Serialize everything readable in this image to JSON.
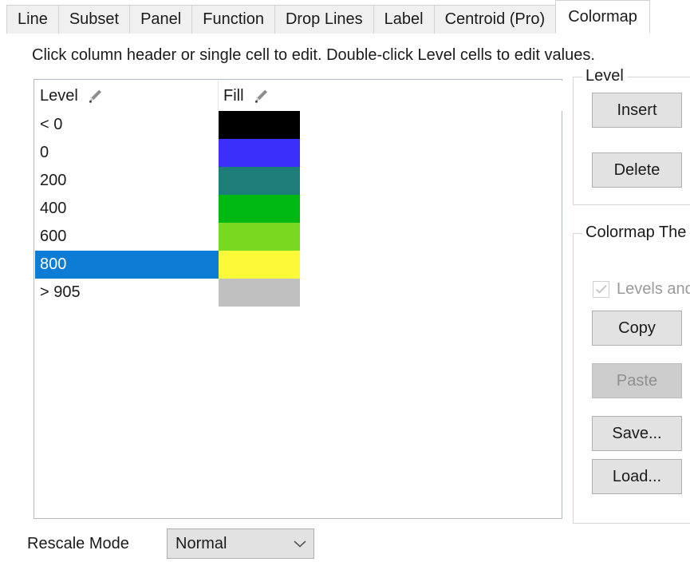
{
  "tabs": [
    {
      "label": "Line",
      "active": false
    },
    {
      "label": "Subset",
      "active": false
    },
    {
      "label": "Panel",
      "active": false
    },
    {
      "label": "Function",
      "active": false
    },
    {
      "label": "Drop Lines",
      "active": false
    },
    {
      "label": "Label",
      "active": false
    },
    {
      "label": "Centroid (Pro)",
      "active": false
    },
    {
      "label": "Colormap",
      "active": true
    }
  ],
  "hint": "Click column header or single cell to edit. Double-click Level cells to edit values.",
  "table": {
    "columns": [
      {
        "key": "level",
        "label": "Level",
        "edit_icon": "pencil-icon"
      },
      {
        "key": "fill",
        "label": "Fill",
        "edit_icon": "pencil-icon"
      }
    ],
    "rows": [
      {
        "level": "< 0",
        "fill": "#000000",
        "selected": false
      },
      {
        "level": "0",
        "fill": "#3b30fb",
        "selected": false
      },
      {
        "level": "200",
        "fill": "#1d7d79",
        "selected": false
      },
      {
        "level": "400",
        "fill": "#00b913",
        "selected": false
      },
      {
        "level": "600",
        "fill": "#79d820",
        "selected": false
      },
      {
        "level": "800",
        "fill": "#fcf938",
        "selected": true
      },
      {
        "level": "> 905",
        "fill": "#c0c0c0",
        "selected": false
      }
    ],
    "selection_color": "#0c7cd5"
  },
  "side": {
    "level_group": {
      "title": "Level",
      "insert_label": "Insert",
      "delete_label": "Delete"
    },
    "theme_group": {
      "title": "Colormap The",
      "checkbox_label": "Levels and",
      "checkbox_checked": true,
      "checkbox_enabled": false,
      "copy_label": "Copy",
      "paste_label": "Paste",
      "paste_enabled": false,
      "save_label": "Save...",
      "load_label": "Load..."
    }
  },
  "bottom": {
    "rescale_label": "Rescale Mode",
    "rescale_value": "Normal"
  }
}
